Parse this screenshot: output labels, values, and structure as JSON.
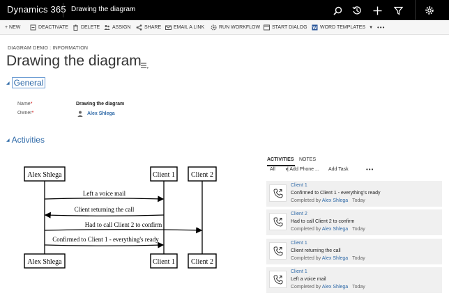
{
  "topbar": {
    "app_name": "Dynamics 365",
    "breadcrumb": "Drawing the diagram",
    "icons": [
      "search-icon",
      "history-icon",
      "plus-icon",
      "filter-icon",
      "gear-icon"
    ]
  },
  "commands": [
    {
      "id": "new",
      "label": "+ NEW",
      "icon": "plus-icon"
    },
    {
      "id": "deactivate",
      "label": "DEACTIVATE",
      "icon": "deactivate-icon"
    },
    {
      "id": "delete",
      "label": "DELETE",
      "icon": "trash-icon"
    },
    {
      "id": "assign",
      "label": "ASSIGN",
      "icon": "assign-icon"
    },
    {
      "id": "share",
      "label": "SHARE",
      "icon": "share-icon"
    },
    {
      "id": "email-link",
      "label": "EMAIL A LINK",
      "icon": "email-icon"
    },
    {
      "id": "run-workflow",
      "label": "RUN WORKFLOW",
      "icon": "workflow-icon"
    },
    {
      "id": "start-dialog",
      "label": "START DIALOG",
      "icon": "dialog-icon"
    },
    {
      "id": "word-templates",
      "label": "WORD TEMPLATES",
      "icon": "word-icon"
    },
    {
      "id": "more",
      "label": "•••",
      "icon": "more-icon"
    }
  ],
  "record": {
    "entity_form": "DIAGRAM DEMO : INFORMATION",
    "title": "Drawing the diagram"
  },
  "general": {
    "header": "General",
    "name_label": "Name",
    "name_value": "Drawing the diagram",
    "owner_label": "Owner",
    "owner_value": "Alex Shlega",
    "required_mark": "*"
  },
  "activities_section": {
    "header": "Activities"
  },
  "diagram": {
    "participants": [
      "Alex Shlega",
      "Client 1",
      "Client 2"
    ],
    "messages": [
      {
        "text": "Left a voice mail",
        "from": 0,
        "to": 1
      },
      {
        "text": "Client returning the call",
        "from": 1,
        "to": 0
      },
      {
        "text": "Had to call Client 2 to confirm",
        "from": 0,
        "to": 2
      },
      {
        "text": "Confirmed to Client 1 - everything's ready",
        "from": 0,
        "to": 1
      }
    ]
  },
  "activity_panel": {
    "tab_activities": "ACTIVITIES",
    "tab_notes": "NOTES",
    "filter_all": "All",
    "add_phone": "| Add Phone ...",
    "add_task": "Add Task",
    "more": "•••",
    "items": [
      {
        "who": "Client 1",
        "subject": "Confirmed to Client 1 - everything's ready",
        "completed_by_label": "Completed by",
        "completed_by": "Alex Shlega",
        "when": "Today"
      },
      {
        "who": "Client 2",
        "subject": "Had to call Client 2 to confirm",
        "completed_by_label": "Completed by",
        "completed_by": "Alex Shlega",
        "when": "Today"
      },
      {
        "who": "Client 1",
        "subject": "Client returning the call",
        "completed_by_label": "Completed by",
        "completed_by": "Alex Shlega",
        "when": "Today"
      },
      {
        "who": "Client 1",
        "subject": "Left a voice mail",
        "completed_by_label": "Completed by",
        "completed_by": "Alex Shlega",
        "when": "Today"
      }
    ]
  },
  "colors": {
    "topbar": "#000000",
    "link": "#2f6aa8",
    "required": "#cc0000",
    "card_bg": "#f0f0f0"
  }
}
